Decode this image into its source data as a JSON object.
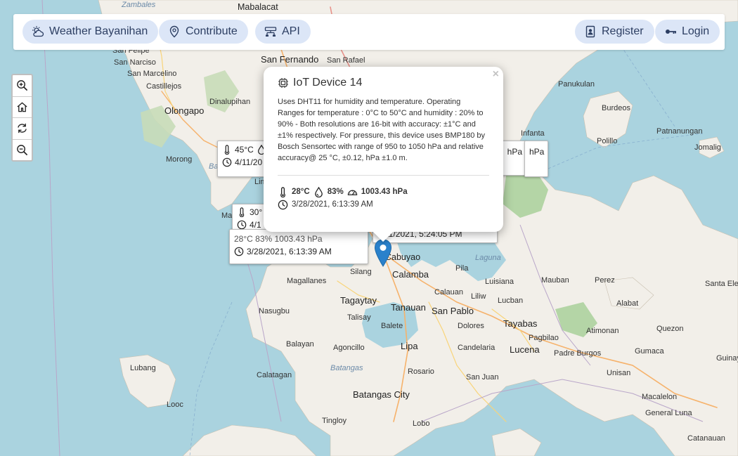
{
  "navbar": {
    "brand": "Weather Bayanihan",
    "contribute": "Contribute",
    "api": "API",
    "register": "Register",
    "login": "Login"
  },
  "controls": [
    "zoom-in",
    "home",
    "refresh",
    "zoom-out"
  ],
  "map_labels": {
    "zambales": "Zambales",
    "mabalacat": "Mabalacat",
    "san_felipe": "San Felipe",
    "san_narciso": "San Narciso",
    "san_fernando": "San Fernando",
    "san_rafael": "San Rafael",
    "san_marcelino": "San Marcelino",
    "castillejos": "Castillejos",
    "olongapo": "Olongapo",
    "dinalupihan": "Dinalupihan",
    "morong": "Morong",
    "bataan": "Bataan",
    "limay": "Limay",
    "mariveles": "Mariveles",
    "panukulan": "Panukulan",
    "burdeos": "Burdeos",
    "patnanungan": "Patnanungan",
    "polillo": "Polillo",
    "infanta": "Infanta",
    "jomalig": "Jomalig",
    "cabuyao": "Cabuyao",
    "calamba": "Calamba",
    "silang": "Silang",
    "laguna": "Laguna",
    "pila": "Pila",
    "magallanes": "Magallanes",
    "tagaytay": "Tagaytay",
    "tanauan": "Tanauan",
    "calauan": "Calauan",
    "luisiana": "Luisiana",
    "mauban": "Mauban",
    "perez": "Perez",
    "santa_elena": "Santa Elen",
    "nasugbu": "Nasugbu",
    "talisay": "Talisay",
    "san_pablo": "San Pablo",
    "liliw": "Liliw",
    "lucban": "Lucban",
    "alabat": "Alabat",
    "tayabas": "Tayabas",
    "balete": "Balete",
    "dolores": "Dolores",
    "atimonan": "Atimonan",
    "quezon": "Quezon",
    "balayan": "Balayan",
    "agoncillo": "Agoncillo",
    "lipa": "Lipa",
    "candelaria": "Candelaria",
    "lucena": "Lucena",
    "pagbilao": "Pagbilao",
    "padre_burgos": "Padre Burgos",
    "gumaca": "Gumaca",
    "guinayangan": "Guinay",
    "lubang": "Lubang",
    "batangas": "Batangas",
    "calatagan": "Calatagan",
    "rosario": "Rosario",
    "san_juan": "San Juan",
    "unisan": "Unisan",
    "macalelon": "Macalelon",
    "looc": "Looc",
    "batangas_city": "Batangas City",
    "tingloy": "Tingloy",
    "lobo": "Lobo",
    "general_luna": "General Luna",
    "catanauan": "Catanauan"
  },
  "tooltips": {
    "t1_temp": "45°C",
    "t1_time": "4/11/20",
    "t2_temp": "30°",
    "t2_time": "4/1",
    "t3_row1": "28°C  83%  1003.43 hPa",
    "t3_time": "3/28/2021, 6:13:39 AM",
    "t4_time": "4/11/2021, 5:24:05 PM",
    "t5_hpa": "hPa",
    "t6_hpa": "hPa"
  },
  "popup": {
    "title": "IoT Device 14",
    "close": "×",
    "description": "Uses DHT11 for humidity and temperature. Operating Ranges for temperature : 0°C to 50°C and humidity : 20% to 90% - Both resolutions are 16-bit with accuracy: ±1°C and ±1% respectively. For pressure, this device uses BMP180 by Bosch Sensortec with range of 950 to 1050 hPa and relative accuracy@ 25 °C, ±0.12, hPa ±1.0 m.",
    "temperature": "28°C",
    "humidity": "83%",
    "pressure": "1003.43 hPa",
    "timestamp": "3/28/2021, 6:13:39 AM"
  },
  "colors": {
    "water": "#aad3df",
    "land": "#f2efe9",
    "forest": "#add19e",
    "nav_button": "#dce6f7",
    "marker": "#2a81cb"
  }
}
